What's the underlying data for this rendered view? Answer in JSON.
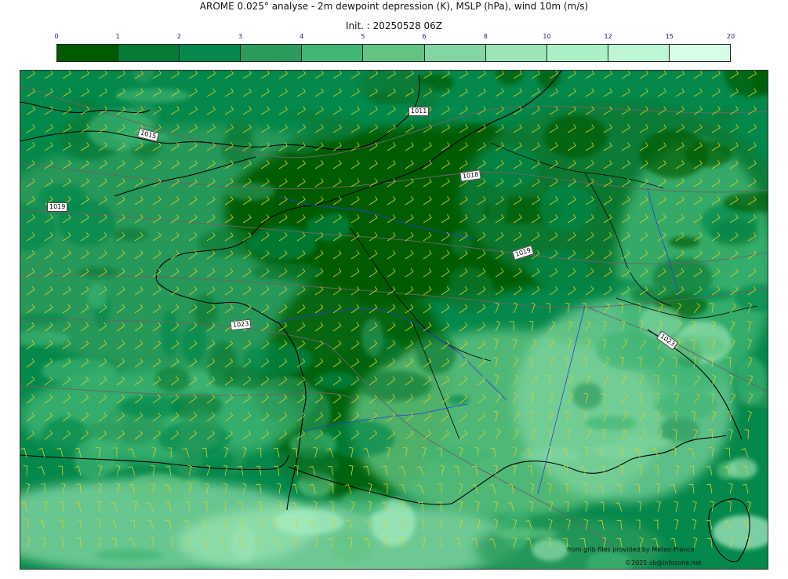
{
  "header": {
    "title": "AROME 0.025° analyse - 2m dewpoint depression (K), MSLP (hPa), wind 10m (m/s)",
    "init": "Init. : 20250528 06Z"
  },
  "legend": {
    "ticks": [
      "0",
      "1",
      "2",
      "3",
      "4",
      "5",
      "6",
      "8",
      "10",
      "12",
      "15",
      "20"
    ],
    "colors": [
      "#005a00",
      "#077a36",
      "#05884b",
      "#2b9a5b",
      "#41b674",
      "#63c482",
      "#81d6a2",
      "#9be4b4",
      "#abf0c4",
      "#bcf6d3",
      "#d6fde6"
    ]
  },
  "map": {
    "isobars": [
      {
        "label": "1011"
      },
      {
        "label": "1015"
      },
      {
        "label": "1019"
      },
      {
        "label": "1018"
      },
      {
        "label": "1019"
      },
      {
        "label": "1023"
      },
      {
        "label": "1023"
      }
    ],
    "coast_color": "#000000",
    "river_color": "#2a3bd8",
    "barb_color": "#d7d12a",
    "isobar_color": "#666666"
  },
  "credits": {
    "source": "from grib files provided by Meteo-France",
    "copyright": "©2025 sb@infozone.net"
  }
}
